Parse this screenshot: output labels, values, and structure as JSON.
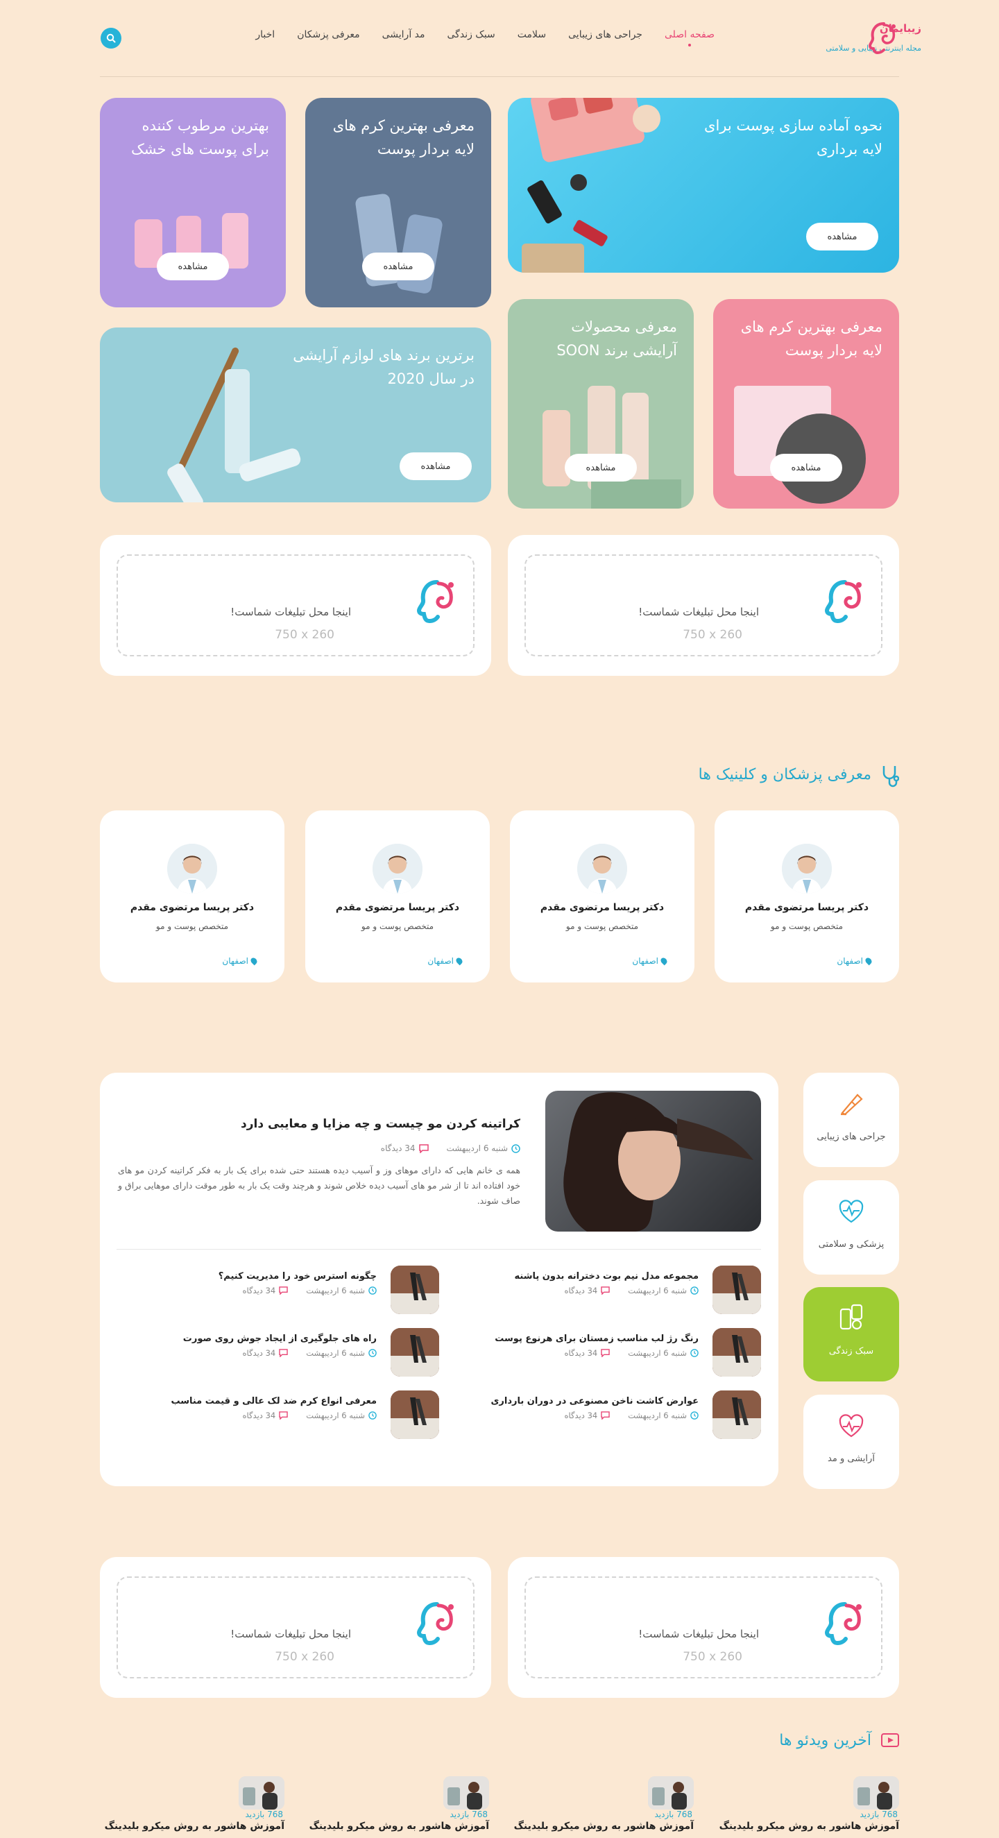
{
  "header": {
    "logo_title": "زیبایمان",
    "logo_subtitle": "مجله اینترنتی زیبایی و سلامتی",
    "nav": [
      "صفحه اصلی",
      "جراحی های زیبایی",
      "سلامت",
      "سبک زندگی",
      "مد آرایشی",
      "معرفی پزشکان",
      "اخبار"
    ],
    "active_nav_index": 0
  },
  "banners": {
    "b1_title": "نحوه آماده سازی پوست برای لایه برداری",
    "b2_title": "معرفی بهترین کرم های لایه بردار پوست",
    "b3_title": "بهترین مرطوب کننده برای پوست های خشک",
    "b4_title": "معرفی بهترین کرم های لایه بردار پوست",
    "b5_title": "معرفی محصولات آرایشی برند SOON",
    "b6_title": "برترین برند های لوازم آرایشی در سال 2020",
    "button_label": "مشاهده"
  },
  "ads": {
    "text": "اینجا محل تبلیغات شماست!",
    "size": "750 x 260"
  },
  "doctors": {
    "section_title": "معرفی پزشکان و کلینیک ها",
    "items": [
      {
        "name": "دکتر پریسا مرتضوی مقدم",
        "specialty": "متخصص پوست و مو",
        "city": "اصفهان"
      },
      {
        "name": "دکتر پریسا مرتضوی مقدم",
        "specialty": "متخصص پوست و مو",
        "city": "اصفهان"
      },
      {
        "name": "دکتر پریسا مرتضوی مقدم",
        "specialty": "متخصص پوست و مو",
        "city": "اصفهان"
      },
      {
        "name": "دکتر پریسا مرتضوی مقدم",
        "specialty": "متخصص پوست و مو",
        "city": "اصفهان"
      }
    ]
  },
  "categories": [
    {
      "label": "جراحی های زیبایی",
      "icon": "scalpel-icon"
    },
    {
      "label": "پزشکی و سلامتی",
      "icon": "heart-pulse-icon"
    },
    {
      "label": "سبک زندگی",
      "icon": "lifestyle-icon",
      "selected": true
    },
    {
      "label": "آرایشی و مد",
      "icon": "heart-wave-icon"
    }
  ],
  "featured": {
    "title": "کراتینه کردن مو چیست و چه مزایا و معایبی دارد",
    "date": "شنبه 6 اردیبهشت",
    "views": "34 دیدگاه",
    "excerpt": "همه ی خانم هایی که دارای موهای وز و آسیب دیده هستند حتی شده برای یک بار به فکر کراتینه کردن مو های خود افتاده اند تا از شر مو های آسیب دیده خلاص شوند و هرچند وقت یک بار به طور موقت دارای موهایی براق و صاف شوند."
  },
  "articles": {
    "right": [
      {
        "title": "مجموعه مدل نیم بوت دخترانه بدون پاشنه",
        "date": "شنبه 6 اردیبهشت",
        "comments": "34 دیدگاه"
      },
      {
        "title": "رنگ رژ لب مناسب زمستان برای هرنوع پوست",
        "date": "شنبه 6 اردیبهشت",
        "comments": "34 دیدگاه"
      },
      {
        "title": "عوارض کاشت ناخن مصنوعی در دوران بارداری",
        "date": "شنبه 6 اردیبهشت",
        "comments": "34 دیدگاه"
      }
    ],
    "left": [
      {
        "title": "چگونه استرس خود را مدیریت کنیم؟",
        "date": "شنبه 6 اردیبهشت",
        "comments": "34 دیدگاه"
      },
      {
        "title": "راه های جلوگیری از ایجاد جوش روی صورت",
        "date": "شنبه 6 اردیبهشت",
        "comments": "34 دیدگاه"
      },
      {
        "title": "معرفی انواع کرم ضد لک عالی و قیمت مناسب",
        "date": "شنبه 6 اردیبهشت",
        "comments": "34 دیدگاه"
      }
    ]
  },
  "videos": {
    "section_title": "آخرین ویدئو ها",
    "items": [
      {
        "title": "آموزش هاشور به روش میکرو بلیدینگ",
        "views": "768 بازدید"
      },
      {
        "title": "آموزش هاشور به روش میکرو بلیدینگ",
        "views": "768 بازدید"
      },
      {
        "title": "آموزش هاشور به روش میکرو بلیدینگ",
        "views": "768 بازدید"
      },
      {
        "title": "آموزش هاشور به روش میکرو بلیدینگ",
        "views": "768 بازدید"
      }
    ]
  },
  "colors": {
    "background": "#fbe8d3",
    "accent_blue": "#26b3d8",
    "accent_pink": "#e84575",
    "lifestyle_green": "#9ecd33"
  }
}
